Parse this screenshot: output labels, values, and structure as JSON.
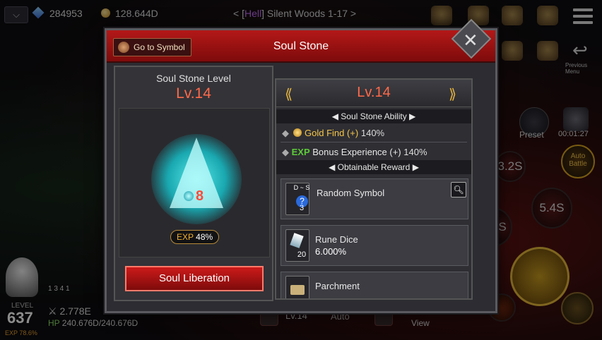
{
  "topbar": {
    "gems": "284953",
    "gold": "128.644D",
    "stage_prefix": "< [",
    "stage_difficulty": "Hell",
    "stage_name": "] Silent Woods 1-17 >",
    "previous_menu_label": "Previous Menu"
  },
  "hud": {
    "preset_label": "Preset",
    "timer": "00:01:27",
    "auto_battle_label": "Auto Battle",
    "skill_cooldowns": [
      "3.2S",
      "5.4S",
      "S"
    ],
    "level_label": "LEVEL",
    "player_level": "637",
    "player_exp": "EXP 78.6%",
    "combat_power": "2.778E",
    "hp_label": "HP",
    "hp_value": "240.676D/240.676D",
    "buffs": "1  3  4  1",
    "bottom_level": "Lv.14",
    "bottom_auto": "Auto",
    "bottom_view": "View"
  },
  "modal": {
    "title": "Soul Stone",
    "goto_label": "Go to Symbol",
    "left": {
      "level_label": "Soul Stone Level",
      "level_value": "Lv.14",
      "shard_count": "8",
      "exp_label": "EXP",
      "exp_value": "48%",
      "liberation_label": "Soul Liberation"
    },
    "right": {
      "level_value": "Lv.14",
      "ability_header": "Soul Stone Ability",
      "abilities": [
        {
          "name": "Gold Find (+)",
          "value": "140%"
        },
        {
          "prefix": "EXP",
          "name": "Bonus Experience (+)",
          "value": "140%"
        }
      ],
      "reward_header": "Obtainable Reward",
      "rewards": [
        {
          "name": "Random Symbol",
          "grade": "D ~ S",
          "count": "3",
          "value": ""
        },
        {
          "name": "Rune Dice",
          "count": "20",
          "value": "6.000%"
        },
        {
          "name": "Parchment",
          "count": "",
          "value": ""
        }
      ]
    }
  },
  "colors": {
    "accent_red": "#b41818",
    "level_orange": "#ff6a4a",
    "gold": "#f5c64a",
    "crystal_cyan": "#55e8e8"
  }
}
